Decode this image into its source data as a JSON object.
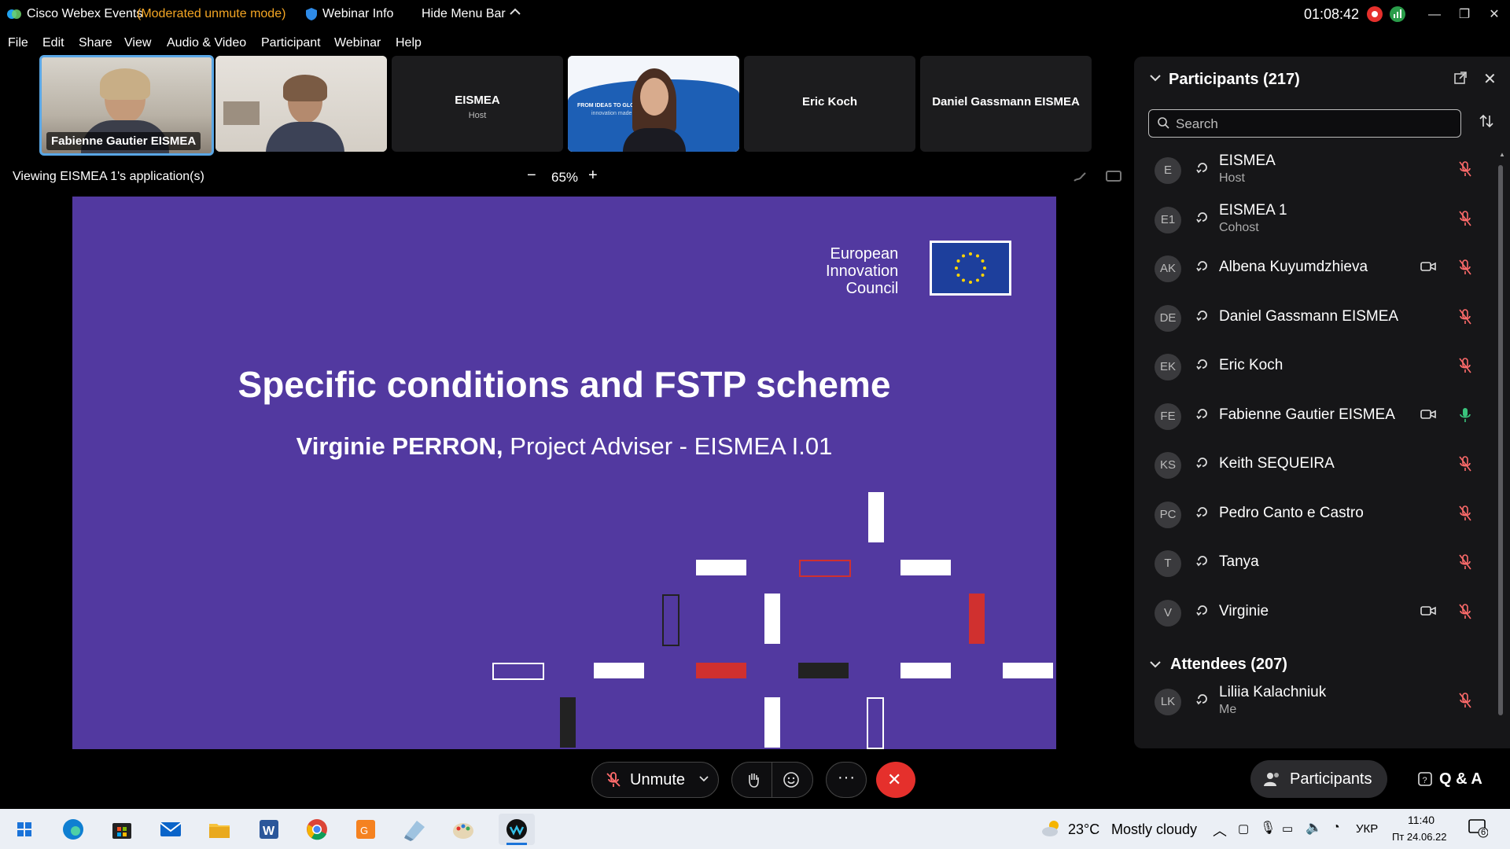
{
  "titlebar": {
    "app_name": "Cisco Webex Events",
    "mode": "(Moderated unmute mode)",
    "webinar_info": "Webinar Info",
    "hide_menu": "Hide Menu Bar",
    "clock": "01:08:42"
  },
  "menu": [
    "File",
    "Edit",
    "Share",
    "View",
    "Audio & Video",
    "Participant",
    "Webinar",
    "Help"
  ],
  "video_strip": [
    {
      "name": "Fabienne Gautier EISMEA",
      "type": "video"
    },
    {
      "name": "",
      "type": "video"
    },
    {
      "name": "EISMEA",
      "sub": "Host",
      "type": "placeholder"
    },
    {
      "name": "",
      "type": "video"
    },
    {
      "name": "Eric Koch",
      "type": "placeholder"
    },
    {
      "name": "Daniel Gassmann EISMEA",
      "type": "placeholder"
    }
  ],
  "share": {
    "viewing": "Viewing EISMEA 1's application(s)",
    "zoom": "65%"
  },
  "slide": {
    "org_line1": "European",
    "org_line2": "Innovation",
    "org_line3": "Council",
    "title": "Specific conditions and FSTP scheme",
    "presenter_name": "Virginie PERRON,",
    "presenter_role": " Project Adviser - EISMEA I.01",
    "strip_text": "FROM IDEAS TO GLOBAL MARKETS:",
    "strip_text2": "innovation made"
  },
  "panel": {
    "participants_header": "Participants (217)",
    "search_placeholder": "Search",
    "participants": [
      {
        "initials": "E",
        "name": "EISMEA",
        "role": "Host",
        "camera": false,
        "mic": "muted"
      },
      {
        "initials": "E1",
        "name": "EISMEA 1",
        "role": "Cohost",
        "camera": false,
        "mic": "muted"
      },
      {
        "initials": "AK",
        "name": "Albena Kuyumdzhieva",
        "role": "",
        "camera": true,
        "mic": "muted"
      },
      {
        "initials": "DE",
        "name": "Daniel Gassmann EISMEA",
        "role": "",
        "camera": false,
        "mic": "muted"
      },
      {
        "initials": "EK",
        "name": "Eric Koch",
        "role": "",
        "camera": false,
        "mic": "muted"
      },
      {
        "initials": "FE",
        "name": "Fabienne Gautier EISMEA",
        "role": "",
        "camera": true,
        "mic": "active"
      },
      {
        "initials": "KS",
        "name": "Keith SEQUEIRA",
        "role": "",
        "camera": false,
        "mic": "muted"
      },
      {
        "initials": "PC",
        "name": "Pedro Canto e Castro",
        "role": "",
        "camera": false,
        "mic": "muted"
      },
      {
        "initials": "T",
        "name": "Tanya",
        "role": "",
        "camera": false,
        "mic": "muted"
      },
      {
        "initials": "V",
        "name": "Virginie",
        "role": "",
        "camera": true,
        "mic": "muted"
      }
    ],
    "attendees_header": "Attendees (207)",
    "attendees": [
      {
        "initials": "LK",
        "name": "Liliia Kalachniuk",
        "role": "Me",
        "camera": false,
        "mic": "muted"
      }
    ]
  },
  "controls": {
    "unmute": "Unmute",
    "participants_button": "Participants",
    "qa_button": "Q & A"
  },
  "taskbar": {
    "weather_temp": "23°C",
    "weather_desc": "Mostly cloudy",
    "language": "УКР",
    "time": "11:40",
    "date": "Пт 24.06.22",
    "notifications": "6"
  },
  "colors": {
    "slide_bg": "#5239a0",
    "accent_red": "#d0302f",
    "mode_orange": "#f5a623",
    "leave_red": "#e5302c"
  }
}
